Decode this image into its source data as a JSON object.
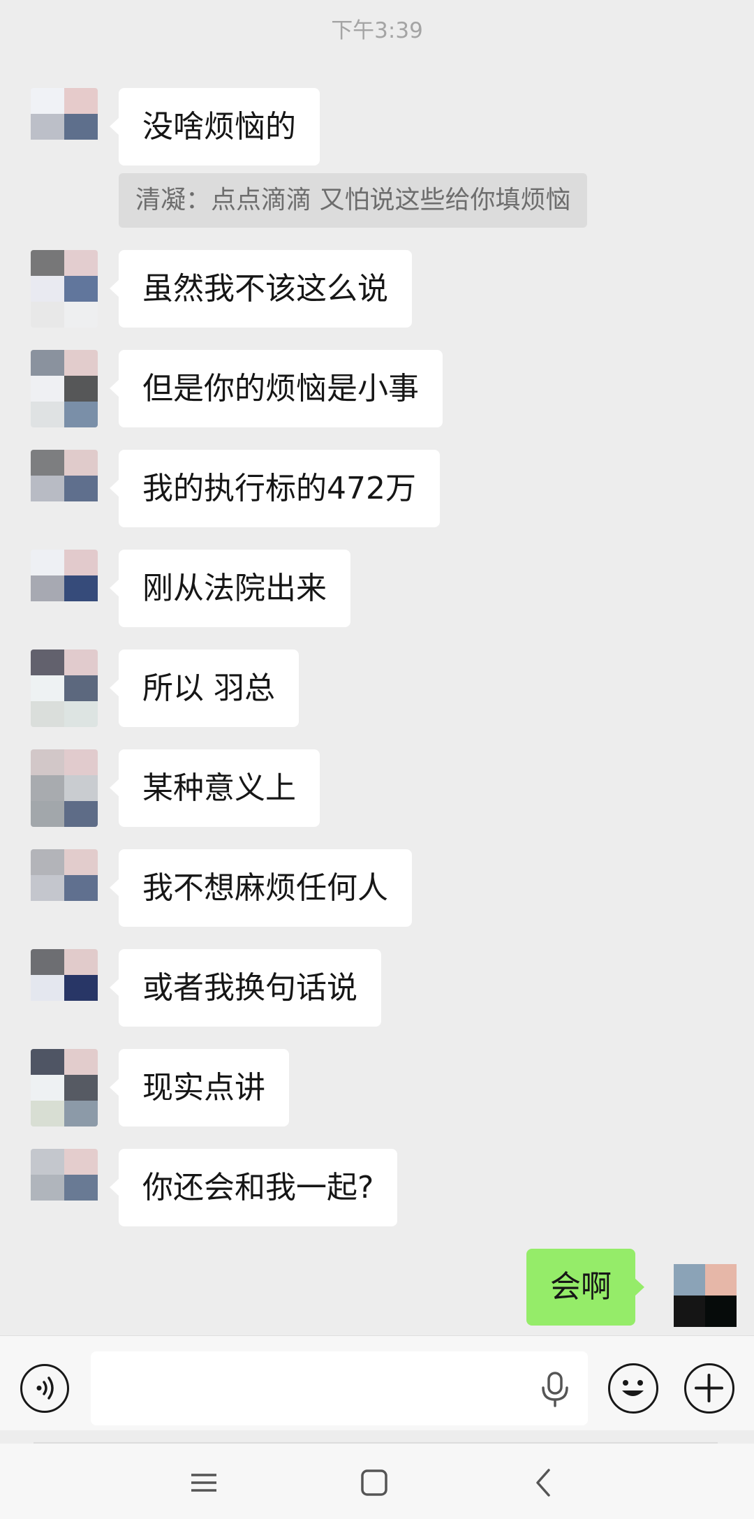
{
  "status": {
    "time": "下午3:39"
  },
  "messages": [
    {
      "side": "left",
      "text": "没啥烦恼的",
      "avatar": [
        "#f0f2f6",
        "#e6cbcb",
        "#bcbfc8",
        "#5e6f8c",
        "#ededed",
        "#ededed"
      ]
    },
    {
      "side": "left",
      "text": "虽然我不该这么说",
      "avatar": [
        "#777778",
        "#e3cdcf",
        "#e9eaf1",
        "#61769c",
        "#e8e8e8",
        "#eeeff0"
      ]
    },
    {
      "side": "left",
      "text": "但是你的烦恼是小事",
      "avatar": [
        "#8a929e",
        "#e2cccc",
        "#eff0f3",
        "#565758",
        "#dfe2e3",
        "#7a8fa8"
      ]
    },
    {
      "side": "left",
      "text": "我的执行标的472万",
      "avatar": [
        "#7d7e80",
        "#e0cbcb",
        "#b8bbc4",
        "#5f6f8d",
        "#ededed",
        "#ededed"
      ]
    },
    {
      "side": "left",
      "text": "刚从法院出来",
      "avatar": [
        "#eef0f4",
        "#e2cacc",
        "#a7a9b2",
        "#364b7a",
        "#ededed",
        "#ededed"
      ]
    },
    {
      "side": "left",
      "text": "所以 羽总",
      "avatar": [
        "#62616d",
        "#e1cbcd",
        "#eef2f3",
        "#5c687e",
        "#dadedb",
        "#dde4e2"
      ]
    },
    {
      "side": "left",
      "text": "某种意义上",
      "avatar": [
        "#d2c7c8",
        "#e1cbcd",
        "#a8abaf",
        "#c9ccd0",
        "#a2a7ab",
        "#5e6c87"
      ]
    },
    {
      "side": "left",
      "text": "我不想麻烦任何人",
      "avatar": [
        "#b3b4b9",
        "#e2cccc",
        "#c4c6cd",
        "#60708f",
        "#ededed",
        "#ededed"
      ]
    },
    {
      "side": "left",
      "text": "或者我换句话说",
      "avatar": [
        "#6d6e72",
        "#e1cbcb",
        "#e4e7ef",
        "#283666",
        "#ededed",
        "#ededed"
      ]
    },
    {
      "side": "left",
      "text": "现实点讲",
      "avatar": [
        "#4f5564",
        "#e2cccc",
        "#eef1f3",
        "#565a63",
        "#d8ded3",
        "#8c9aa8"
      ]
    },
    {
      "side": "left",
      "text": "你还会和我一起?",
      "avatar": [
        "#c4c7cd",
        "#e4cdcd",
        "#b0b5bc",
        "#697a94",
        "#ededed",
        "#ededed"
      ]
    }
  ],
  "quote": {
    "text": "清凝：点点滴滴 又怕说这些给你填烦恼"
  },
  "my_message": {
    "text": "会啊",
    "bubble_color": "#95ec69",
    "avatar": [
      "#8ba3b7",
      "#e6b7a8",
      "#151515",
      "#060b0a"
    ]
  },
  "input_bar": {
    "voice_icon": "voice-wave-icon",
    "mic_icon": "microphone-icon",
    "emoji_icon": "smiley-icon",
    "plus_icon": "plus-icon",
    "value": ""
  },
  "nav_bar": {
    "menu_icon": "menu-icon",
    "home_icon": "home-square-icon",
    "back_icon": "back-chevron-icon"
  }
}
